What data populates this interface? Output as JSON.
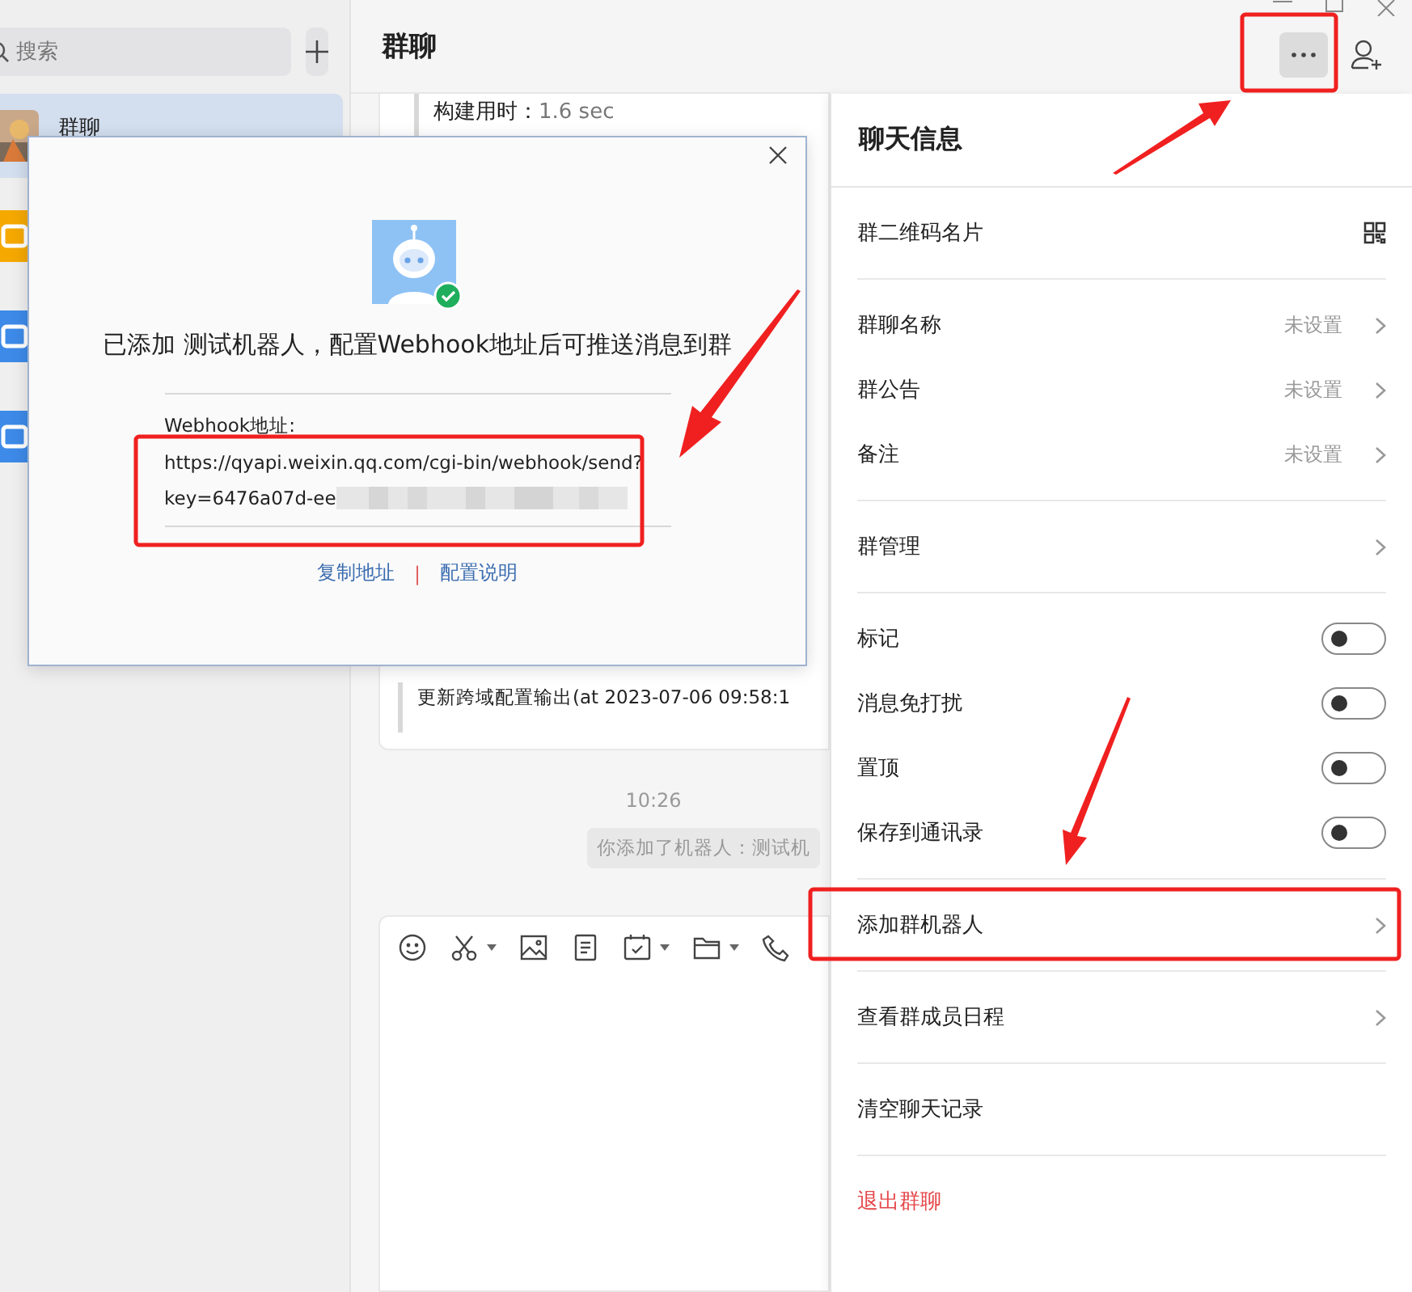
{
  "sidebar": {
    "search": {
      "placeholder": "搜索"
    },
    "chats": [
      {
        "name": "群聊",
        "selected": true
      },
      {
        "kind": "app",
        "color": "#f5a800",
        "selected": false
      },
      {
        "kind": "app",
        "color": "#3d8ae8",
        "selected": false
      },
      {
        "kind": "app",
        "color": "#3d8ae8",
        "selected": false
      }
    ]
  },
  "chat": {
    "title": "群聊",
    "card": {
      "label": "构建用时：",
      "value": "1.6 sec",
      "last_line": "更新跨域配置输出(at 2023-07-06 09:58:1"
    },
    "time": "10:26",
    "system_message": "你添加了机器人：测试机"
  },
  "info_panel": {
    "title": "聊天信息",
    "sections": [
      [
        {
          "label": "群二维码名片",
          "kind": "qr"
        }
      ],
      [
        {
          "label": "群聊名称",
          "kind": "link",
          "value": "未设置"
        },
        {
          "label": "群公告",
          "kind": "link",
          "value": "未设置"
        },
        {
          "label": "备注",
          "kind": "link",
          "value": "未设置"
        }
      ],
      [
        {
          "label": "群管理",
          "kind": "link"
        }
      ],
      [
        {
          "label": "标记",
          "kind": "toggle",
          "on": false
        },
        {
          "label": "消息免打扰",
          "kind": "toggle",
          "on": false
        },
        {
          "label": "置顶",
          "kind": "toggle",
          "on": false
        },
        {
          "label": "保存到通讯录",
          "kind": "toggle",
          "on": false
        }
      ],
      [
        {
          "label": "添加群机器人",
          "kind": "link"
        }
      ],
      [
        {
          "label": "查看群成员日程",
          "kind": "link"
        }
      ],
      [
        {
          "label": "清空聊天记录",
          "kind": "action"
        }
      ],
      [
        {
          "label": "退出群聊",
          "kind": "danger"
        }
      ]
    ]
  },
  "dialog": {
    "message": "已添加 测试机器人，配置Webhook地址后可推送消息到群",
    "webhook_label": "Webhook地址:",
    "url_line": "https://qyapi.weixin.qq.com/cgi-bin/webhook/send?",
    "key_line": "key=6476a07d-ee",
    "links": [
      "复制地址",
      "配置说明"
    ],
    "separator": "|"
  }
}
